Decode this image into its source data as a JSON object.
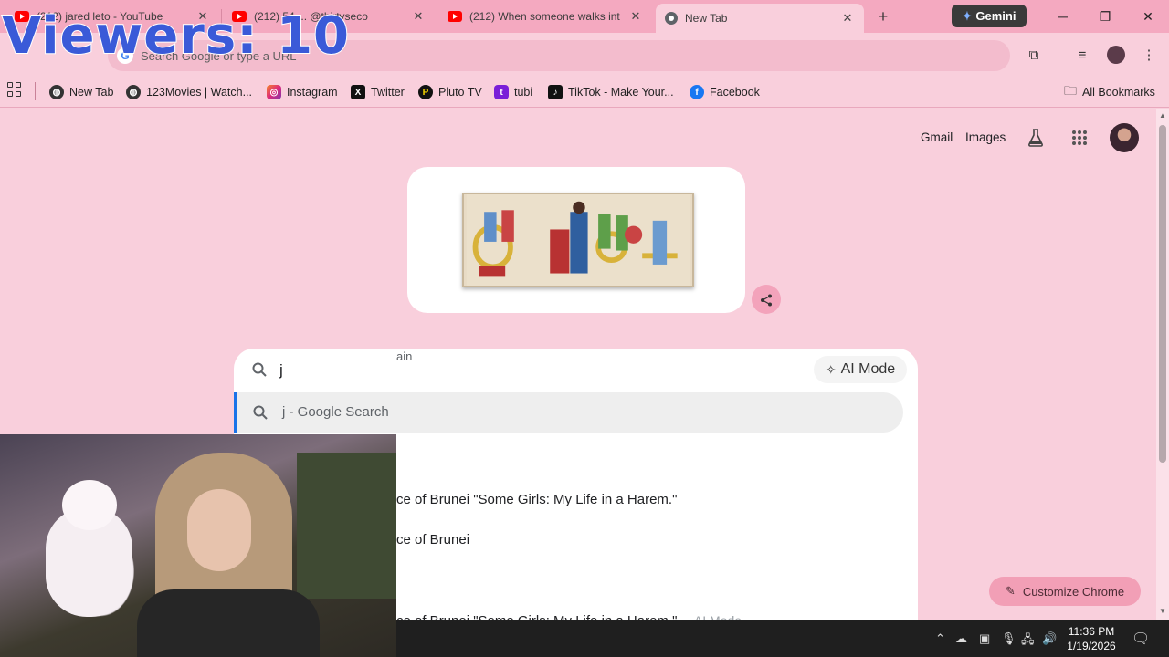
{
  "tabs": [
    {
      "title": "(212) jared leto - YouTube",
      "icon": "youtube-icon"
    },
    {
      "title": "(212) 54 ... @thirtyseco",
      "icon": "youtube-icon"
    },
    {
      "title": "(212) When someone walks int",
      "icon": "youtube-icon"
    },
    {
      "title": "New Tab",
      "icon": "chrome-icon"
    }
  ],
  "gemini_label": "Gemini",
  "omnibox": {
    "placeholder": "Search Google or type a URL"
  },
  "bookmarks": [
    {
      "label": "New Tab"
    },
    {
      "label": "123Movies | Watch..."
    },
    {
      "label": "Instagram"
    },
    {
      "label": "Twitter"
    },
    {
      "label": "Pluto TV"
    },
    {
      "label": "tubi"
    },
    {
      "label": "TikTok - Make Your..."
    },
    {
      "label": "Facebook"
    }
  ],
  "all_bookmarks": "All Bookmarks",
  "google_links": {
    "gmail": "Gmail",
    "images": "Images"
  },
  "search": {
    "value": "j",
    "ai_mode": "AI Mode"
  },
  "suggestions": {
    "highlighted": "j - Google Search",
    "section": "ain",
    "items": [
      "ce of Brunei \"Some Girls: My Life in a Harem.\"",
      "ce of Brunei",
      "ce of Brunei \"Some Girls: My Life in a Harem.\""
    ],
    "trailing_ai_mode": "AI Mode"
  },
  "customize_label": "Customize Chrome",
  "clock": {
    "time": "11:36 PM",
    "date": "1/19/2026"
  },
  "overlay": {
    "viewers": "Viewers: 10"
  }
}
